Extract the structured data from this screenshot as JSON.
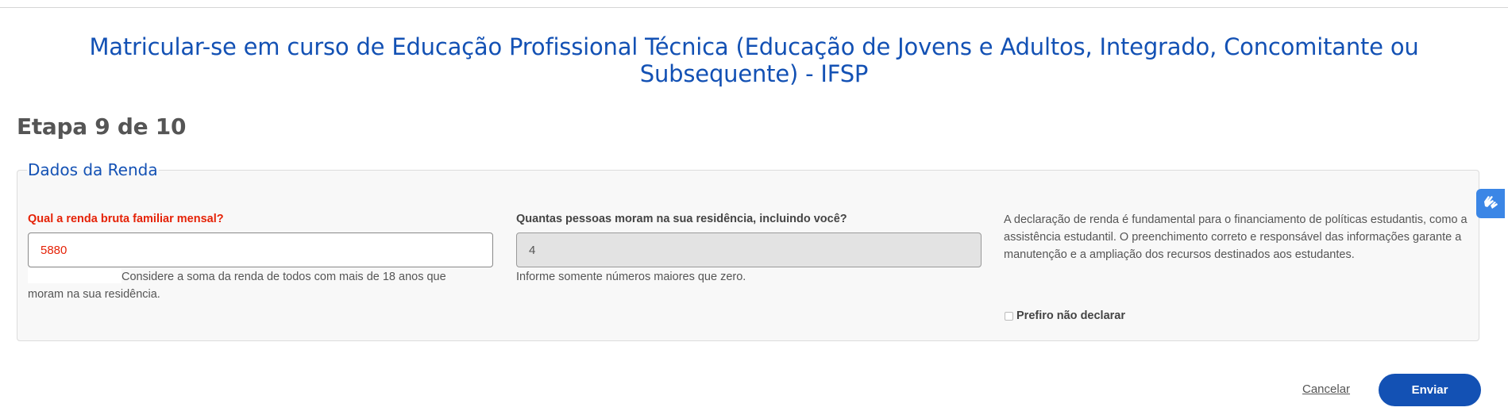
{
  "page": {
    "title": "Matricular-se em curso de Educação Profissional Técnica (Educação de Jovens e Adultos, Integrado, Concomitante ou Subsequente) - IFSP",
    "step": "Etapa 9 de 10"
  },
  "section": {
    "legend": "Dados da Renda",
    "income": {
      "label": "Qual a renda bruta familiar mensal?",
      "value": "5880",
      "help": "Considere a soma da renda de todos com mais de 18 anos que moram na sua residência."
    },
    "household": {
      "label": "Quantas pessoas moram na sua residência, incluindo você?",
      "value": "4",
      "help": "Informe somente números maiores que zero."
    },
    "info_text": "A declaração de renda é fundamental para o financiamento de políticas estudantis, como a assistência estudantil. O preenchimento correto e responsável das informações garante a manutenção e a ampliação dos recursos destinados aos estudantes.",
    "decline": {
      "label": "Prefiro não declarar",
      "checked": false
    }
  },
  "actions": {
    "cancel_label": "Cancelar",
    "submit_label": "Enviar"
  },
  "widgets": {
    "accessibility_icon": "sign-language-hands-icon"
  },
  "colors": {
    "primary": "#1351b4",
    "required": "#e52207",
    "panel_background": "#f8f8f8",
    "widget": "#3b86e6"
  }
}
